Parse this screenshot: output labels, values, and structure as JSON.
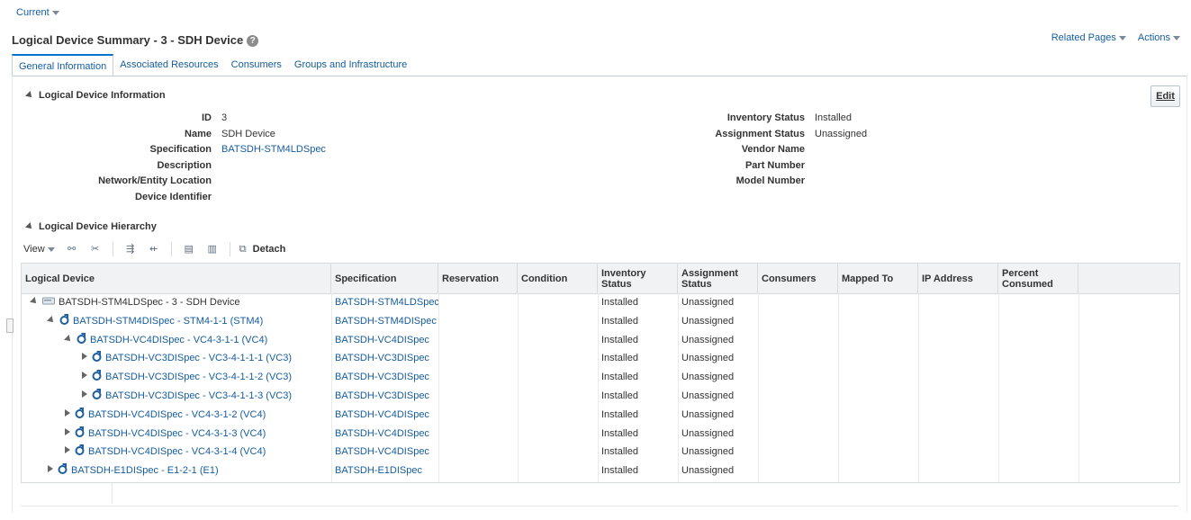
{
  "top": {
    "current_label": "Current",
    "page_title": "Logical Device Summary - 3 - SDH Device",
    "related_pages": "Related Pages",
    "actions": "Actions"
  },
  "tabs": [
    {
      "label": "General Information",
      "active": true
    },
    {
      "label": "Associated Resources"
    },
    {
      "label": "Consumers"
    },
    {
      "label": "Groups and Infrastructure"
    }
  ],
  "info_section": {
    "title": "Logical Device Information",
    "edit_label": "Edit",
    "left_fields": [
      {
        "label": "ID",
        "value": "3"
      },
      {
        "label": "Name",
        "value": "SDH Device"
      },
      {
        "label": "Specification",
        "value": "BATSDH-STM4LDSpec"
      },
      {
        "label": "Description",
        "value": ""
      },
      {
        "label": "Network/Entity Location",
        "value": ""
      },
      {
        "label": "Device Identifier",
        "value": ""
      }
    ],
    "right_fields": [
      {
        "label": "Inventory Status",
        "value": "Installed"
      },
      {
        "label": "Assignment Status",
        "value": "Unassigned"
      },
      {
        "label": "Vendor Name",
        "value": ""
      },
      {
        "label": "Part Number",
        "value": ""
      },
      {
        "label": "Model Number",
        "value": ""
      }
    ]
  },
  "hierarchy": {
    "title": "Logical Device Hierarchy",
    "view_label": "View",
    "detach_label": "Detach",
    "columns": [
      "Logical Device",
      "Specification",
      "Reservation",
      "Condition",
      "Inventory Status",
      "Assignment Status",
      "Consumers",
      "Mapped To",
      "IP Address",
      "Percent Consumed"
    ],
    "rows": [
      {
        "name": "BATSDH-STM4LDSpec - 3 - SDH Device",
        "spec": "BATSDH-STM4LDSpec",
        "inventory": "Installed",
        "assignment": "Unassigned",
        "level": 0,
        "state": "open",
        "icon": "device-icon",
        "is_link": false
      },
      {
        "name": "BATSDH-STM4DISpec - STM4-1-1 (STM4)",
        "spec": "BATSDH-STM4DISpec",
        "inventory": "Installed",
        "assignment": "Unassigned",
        "level": 1,
        "state": "open",
        "icon": "interface-icon",
        "is_link": true
      },
      {
        "name": "BATSDH-VC4DISpec - VC4-3-1-1 (VC4)",
        "spec": "BATSDH-VC4DISpec",
        "inventory": "Installed",
        "assignment": "Unassigned",
        "level": 2,
        "state": "open",
        "icon": "interface-icon",
        "is_link": true
      },
      {
        "name": "BATSDH-VC3DISpec - VC3-4-1-1-1 (VC3)",
        "spec": "BATSDH-VC3DISpec",
        "inventory": "Installed",
        "assignment": "Unassigned",
        "level": 3,
        "state": "closed",
        "icon": "interface-icon",
        "is_link": true
      },
      {
        "name": "BATSDH-VC3DISpec - VC3-4-1-1-2 (VC3)",
        "spec": "BATSDH-VC3DISpec",
        "inventory": "Installed",
        "assignment": "Unassigned",
        "level": 3,
        "state": "closed",
        "icon": "interface-icon",
        "is_link": true
      },
      {
        "name": "BATSDH-VC3DISpec - VC3-4-1-1-3 (VC3)",
        "spec": "BATSDH-VC3DISpec",
        "inventory": "Installed",
        "assignment": "Unassigned",
        "level": 3,
        "state": "closed",
        "icon": "interface-icon",
        "is_link": true
      },
      {
        "name": "BATSDH-VC4DISpec - VC4-3-1-2 (VC4)",
        "spec": "BATSDH-VC4DISpec",
        "inventory": "Installed",
        "assignment": "Unassigned",
        "level": 2,
        "state": "closed",
        "icon": "interface-icon",
        "is_link": true
      },
      {
        "name": "BATSDH-VC4DISpec - VC4-3-1-3 (VC4)",
        "spec": "BATSDH-VC4DISpec",
        "inventory": "Installed",
        "assignment": "Unassigned",
        "level": 2,
        "state": "closed",
        "icon": "interface-icon",
        "is_link": true
      },
      {
        "name": "BATSDH-VC4DISpec - VC4-3-1-4 (VC4)",
        "spec": "BATSDH-VC4DISpec",
        "inventory": "Installed",
        "assignment": "Unassigned",
        "level": 2,
        "state": "closed",
        "icon": "interface-icon",
        "is_link": true
      },
      {
        "name": "BATSDH-E1DISpec - E1-2-1 (E1)",
        "spec": "BATSDH-E1DISpec",
        "inventory": "Installed",
        "assignment": "Unassigned",
        "level": 1,
        "state": "closed",
        "icon": "interface-icon",
        "is_link": true
      }
    ]
  },
  "colors": {
    "link": "#145c9e",
    "accent": "#0572ce",
    "header_bg": "#f0f2f4"
  }
}
